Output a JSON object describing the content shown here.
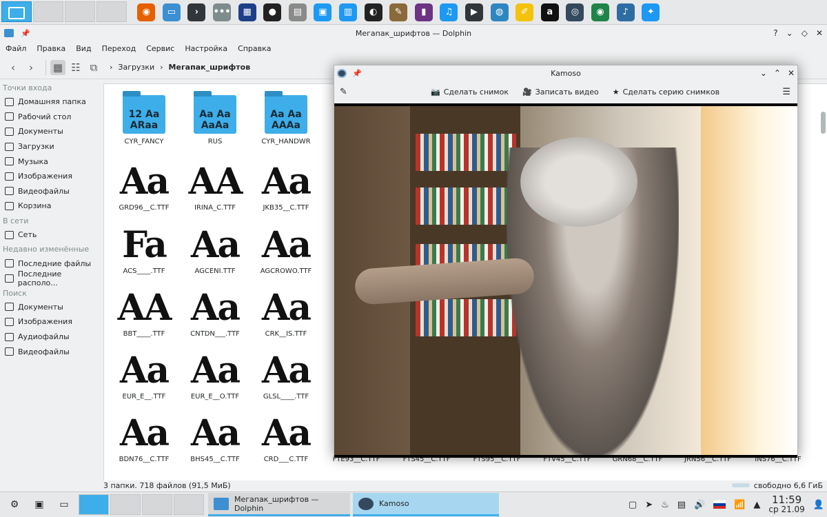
{
  "top_panel": {
    "launchers": [
      {
        "name": "firefox-icon",
        "glyph": "◉",
        "color": "#e66000"
      },
      {
        "name": "files-icon",
        "glyph": "▭",
        "color": "#3d8fd1"
      },
      {
        "name": "terminal-icon",
        "glyph": "›",
        "color": "#31363b"
      },
      {
        "name": "dots-icon",
        "glyph": "•••",
        "color": "#7f8c8d"
      },
      {
        "name": "video-editor-icon",
        "glyph": "▦",
        "color": "#1d3f8a"
      },
      {
        "name": "disc-icon",
        "glyph": "●",
        "color": "#222"
      },
      {
        "name": "document-icon",
        "glyph": "▤",
        "color": "#8a8a8a"
      },
      {
        "name": "store-icon",
        "glyph": "▣",
        "color": "#1d99f3"
      },
      {
        "name": "text-editor-icon",
        "glyph": "▥",
        "color": "#1d99f3"
      },
      {
        "name": "penguin-icon",
        "glyph": "◐",
        "color": "#222"
      },
      {
        "name": "gimp-icon",
        "glyph": "✎",
        "color": "#8a6a3a"
      },
      {
        "name": "media-icon",
        "glyph": "▮",
        "color": "#6c3483"
      },
      {
        "name": "headphones-icon",
        "glyph": "♫",
        "color": "#1d99f3"
      },
      {
        "name": "film-icon",
        "glyph": "▶",
        "color": "#31363b"
      },
      {
        "name": "network-icon",
        "glyph": "◍",
        "color": "#2e86c1"
      },
      {
        "name": "notes-icon",
        "glyph": "✐",
        "color": "#f4c20d"
      },
      {
        "name": "a-icon",
        "glyph": "a",
        "color": "#111"
      },
      {
        "name": "webcam-icon",
        "glyph": "◎",
        "color": "#34495e"
      },
      {
        "name": "globe-icon",
        "glyph": "◉",
        "color": "#1e8449"
      },
      {
        "name": "bookmark-icon",
        "glyph": "♪",
        "color": "#2e6da4"
      },
      {
        "name": "settings-icon",
        "glyph": "✦",
        "color": "#1d99f3"
      }
    ]
  },
  "dolphin": {
    "title": "Мегапак_шрифтов — Dolphin",
    "menu": [
      "Файл",
      "Правка",
      "Вид",
      "Переход",
      "Сервис",
      "Настройка",
      "Справка"
    ],
    "breadcrumb": {
      "parent": "Загрузки",
      "current": "Мегапак_шрифтов"
    },
    "places": {
      "sections": [
        {
          "header": "Точки входа",
          "items": [
            "Домашняя папка",
            "Рабочий стол",
            "Документы",
            "Загрузки",
            "Музыка",
            "Изображения",
            "Видеофайлы",
            "Корзина"
          ]
        },
        {
          "header": "В сети",
          "items": [
            "Сеть"
          ]
        },
        {
          "header": "Недавно изменённые",
          "items": [
            "Последние файлы",
            "Последние располо..."
          ]
        },
        {
          "header": "Поиск",
          "items": [
            "Документы",
            "Изображения",
            "Аудиофайлы",
            "Видеофайлы"
          ]
        }
      ]
    },
    "files": [
      {
        "name": "CYR_FANCY",
        "kind": "folder",
        "preview": "12 Aa ARaa"
      },
      {
        "name": "RUS",
        "kind": "folder",
        "preview": "Aa Aa AaAa"
      },
      {
        "name": "CYR_HANDWR",
        "kind": "folder",
        "preview": "Aa Aa AAAa"
      },
      {
        "name": "GRD96__C.TTF",
        "kind": "font",
        "preview": "Aa"
      },
      {
        "name": "IRINA_C.TTF",
        "kind": "font",
        "preview": "AA"
      },
      {
        "name": "JKB35__C.TTF",
        "kind": "font",
        "preview": "Aa"
      },
      {
        "name": "ACS____.TTF",
        "kind": "font",
        "preview": "Fa"
      },
      {
        "name": "AGCENI.TTF",
        "kind": "font",
        "preview": "Aa"
      },
      {
        "name": "AGCROWO.TTF",
        "kind": "font",
        "preview": "Aa"
      },
      {
        "name": "BBT____.TTF",
        "kind": "font",
        "preview": "AA"
      },
      {
        "name": "CNTDN___.TTF",
        "kind": "font",
        "preview": "Aa"
      },
      {
        "name": "CRK__IS.TTF",
        "kind": "font",
        "preview": "Aa"
      },
      {
        "name": "EUR_E__.TTF",
        "kind": "font",
        "preview": "Aa"
      },
      {
        "name": "EUR_E__O.TTF",
        "kind": "font",
        "preview": "Aa"
      },
      {
        "name": "GLSL____.TTF",
        "kind": "font",
        "preview": "Aa"
      },
      {
        "name": "BDN76__C.TTF",
        "kind": "font",
        "preview": "Aa"
      },
      {
        "name": "BHS45__C.TTF",
        "kind": "font",
        "preview": "Aa"
      },
      {
        "name": "CRD___C.TTF",
        "kind": "font",
        "preview": "Aa"
      },
      {
        "name": "FTE93__C.TTF",
        "kind": "font",
        "preview": ""
      },
      {
        "name": "FTS45__C.TTF",
        "kind": "font",
        "preview": ""
      },
      {
        "name": "FTS95__C.TTF",
        "kind": "font",
        "preview": ""
      },
      {
        "name": "FTV45__C.TTF",
        "kind": "font",
        "preview": ""
      },
      {
        "name": "GRN68__C.TTF",
        "kind": "font",
        "preview": ""
      },
      {
        "name": "JRN56__C.TTF",
        "kind": "font",
        "preview": ""
      },
      {
        "name": "INS76__C.TTF",
        "kind": "font",
        "preview": ""
      }
    ],
    "status": {
      "summary": "3 папки. 718 файлов (91,5 МиБ)",
      "free": "свободно 6,6 ГиБ"
    }
  },
  "kamoso": {
    "title": "Kamoso",
    "actions": [
      "Сделать снимок",
      "Записать видео",
      "Сделать серию снимков"
    ]
  },
  "taskbar": {
    "tasks": [
      "Мегапак_шрифтов — Dolphin",
      "Kamoso"
    ],
    "time": "11:59",
    "date": "ср 21.09",
    "colors": {
      "accent": "#3daee9",
      "active_task": "#a7d7f0"
    }
  }
}
